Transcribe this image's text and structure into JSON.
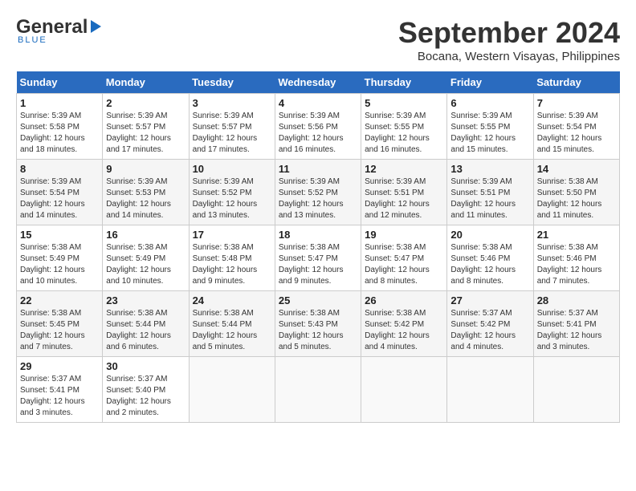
{
  "header": {
    "logo_general": "General",
    "logo_blue": "Blue",
    "month": "September 2024",
    "location": "Bocana, Western Visayas, Philippines"
  },
  "weekdays": [
    "Sunday",
    "Monday",
    "Tuesday",
    "Wednesday",
    "Thursday",
    "Friday",
    "Saturday"
  ],
  "weeks": [
    [
      {
        "day": "1",
        "sunrise": "5:39 AM",
        "sunset": "5:58 PM",
        "daylight": "12 hours and 18 minutes."
      },
      {
        "day": "2",
        "sunrise": "5:39 AM",
        "sunset": "5:57 PM",
        "daylight": "12 hours and 17 minutes."
      },
      {
        "day": "3",
        "sunrise": "5:39 AM",
        "sunset": "5:57 PM",
        "daylight": "12 hours and 17 minutes."
      },
      {
        "day": "4",
        "sunrise": "5:39 AM",
        "sunset": "5:56 PM",
        "daylight": "12 hours and 16 minutes."
      },
      {
        "day": "5",
        "sunrise": "5:39 AM",
        "sunset": "5:55 PM",
        "daylight": "12 hours and 16 minutes."
      },
      {
        "day": "6",
        "sunrise": "5:39 AM",
        "sunset": "5:55 PM",
        "daylight": "12 hours and 15 minutes."
      },
      {
        "day": "7",
        "sunrise": "5:39 AM",
        "sunset": "5:54 PM",
        "daylight": "12 hours and 15 minutes."
      }
    ],
    [
      {
        "day": "8",
        "sunrise": "5:39 AM",
        "sunset": "5:54 PM",
        "daylight": "12 hours and 14 minutes."
      },
      {
        "day": "9",
        "sunrise": "5:39 AM",
        "sunset": "5:53 PM",
        "daylight": "12 hours and 14 minutes."
      },
      {
        "day": "10",
        "sunrise": "5:39 AM",
        "sunset": "5:52 PM",
        "daylight": "12 hours and 13 minutes."
      },
      {
        "day": "11",
        "sunrise": "5:39 AM",
        "sunset": "5:52 PM",
        "daylight": "12 hours and 13 minutes."
      },
      {
        "day": "12",
        "sunrise": "5:39 AM",
        "sunset": "5:51 PM",
        "daylight": "12 hours and 12 minutes."
      },
      {
        "day": "13",
        "sunrise": "5:39 AM",
        "sunset": "5:51 PM",
        "daylight": "12 hours and 11 minutes."
      },
      {
        "day": "14",
        "sunrise": "5:38 AM",
        "sunset": "5:50 PM",
        "daylight": "12 hours and 11 minutes."
      }
    ],
    [
      {
        "day": "15",
        "sunrise": "5:38 AM",
        "sunset": "5:49 PM",
        "daylight": "12 hours and 10 minutes."
      },
      {
        "day": "16",
        "sunrise": "5:38 AM",
        "sunset": "5:49 PM",
        "daylight": "12 hours and 10 minutes."
      },
      {
        "day": "17",
        "sunrise": "5:38 AM",
        "sunset": "5:48 PM",
        "daylight": "12 hours and 9 minutes."
      },
      {
        "day": "18",
        "sunrise": "5:38 AM",
        "sunset": "5:47 PM",
        "daylight": "12 hours and 9 minutes."
      },
      {
        "day": "19",
        "sunrise": "5:38 AM",
        "sunset": "5:47 PM",
        "daylight": "12 hours and 8 minutes."
      },
      {
        "day": "20",
        "sunrise": "5:38 AM",
        "sunset": "5:46 PM",
        "daylight": "12 hours and 8 minutes."
      },
      {
        "day": "21",
        "sunrise": "5:38 AM",
        "sunset": "5:46 PM",
        "daylight": "12 hours and 7 minutes."
      }
    ],
    [
      {
        "day": "22",
        "sunrise": "5:38 AM",
        "sunset": "5:45 PM",
        "daylight": "12 hours and 7 minutes."
      },
      {
        "day": "23",
        "sunrise": "5:38 AM",
        "sunset": "5:44 PM",
        "daylight": "12 hours and 6 minutes."
      },
      {
        "day": "24",
        "sunrise": "5:38 AM",
        "sunset": "5:44 PM",
        "daylight": "12 hours and 5 minutes."
      },
      {
        "day": "25",
        "sunrise": "5:38 AM",
        "sunset": "5:43 PM",
        "daylight": "12 hours and 5 minutes."
      },
      {
        "day": "26",
        "sunrise": "5:38 AM",
        "sunset": "5:42 PM",
        "daylight": "12 hours and 4 minutes."
      },
      {
        "day": "27",
        "sunrise": "5:37 AM",
        "sunset": "5:42 PM",
        "daylight": "12 hours and 4 minutes."
      },
      {
        "day": "28",
        "sunrise": "5:37 AM",
        "sunset": "5:41 PM",
        "daylight": "12 hours and 3 minutes."
      }
    ],
    [
      {
        "day": "29",
        "sunrise": "5:37 AM",
        "sunset": "5:41 PM",
        "daylight": "12 hours and 3 minutes."
      },
      {
        "day": "30",
        "sunrise": "5:37 AM",
        "sunset": "5:40 PM",
        "daylight": "12 hours and 2 minutes."
      },
      null,
      null,
      null,
      null,
      null
    ]
  ]
}
